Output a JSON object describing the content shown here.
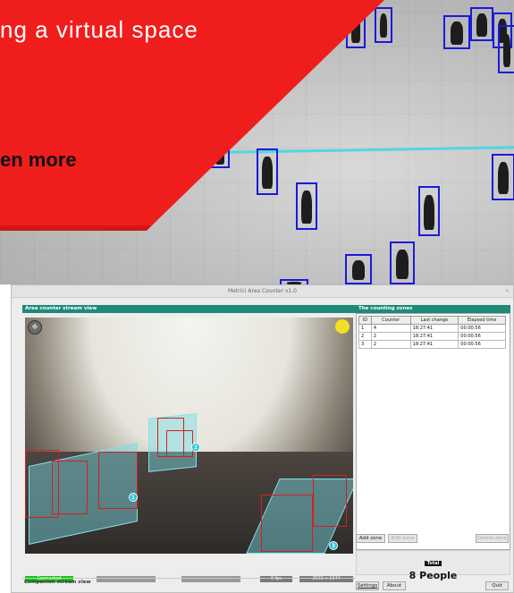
{
  "banner": {
    "line1": "ng a virtual space",
    "line2": "en more",
    "color": "#f01d1d"
  },
  "window": {
    "title": "Metrici Area Counter v1.0",
    "close_glyph": "×"
  },
  "stream_panel": {
    "title": "Area counter stream view",
    "zone_labels": [
      "1",
      "2",
      "3"
    ],
    "status": {
      "connected": "Connected",
      "fps": "0 fps",
      "resolution": "2592 x 1944"
    },
    "companion_title": "Companion stream view"
  },
  "zones_panel": {
    "title": "The counting zones",
    "columns": [
      "ID",
      "Counter",
      "Last change",
      "Elapsed time"
    ],
    "rows": [
      [
        "1",
        "4",
        "18:27:41",
        "00:00:56"
      ],
      [
        "2",
        "2",
        "18:27:41",
        "00:00:56"
      ],
      [
        "3",
        "2",
        "18:27:41",
        "00:00:56"
      ]
    ],
    "buttons": {
      "add_zone": "Add zone",
      "edit_zone": "Edit zone",
      "delete_zone": "Delete zone"
    }
  },
  "total": {
    "label": "Total",
    "value": "8 People"
  },
  "footer": {
    "settings": "Settings",
    "about": "About",
    "quit": "Quit"
  },
  "colors": {
    "panel_header": "#1d8a7a",
    "connected": "#16c316",
    "detection_box": "#1a1adb",
    "zone_fill": "#78dce6"
  }
}
